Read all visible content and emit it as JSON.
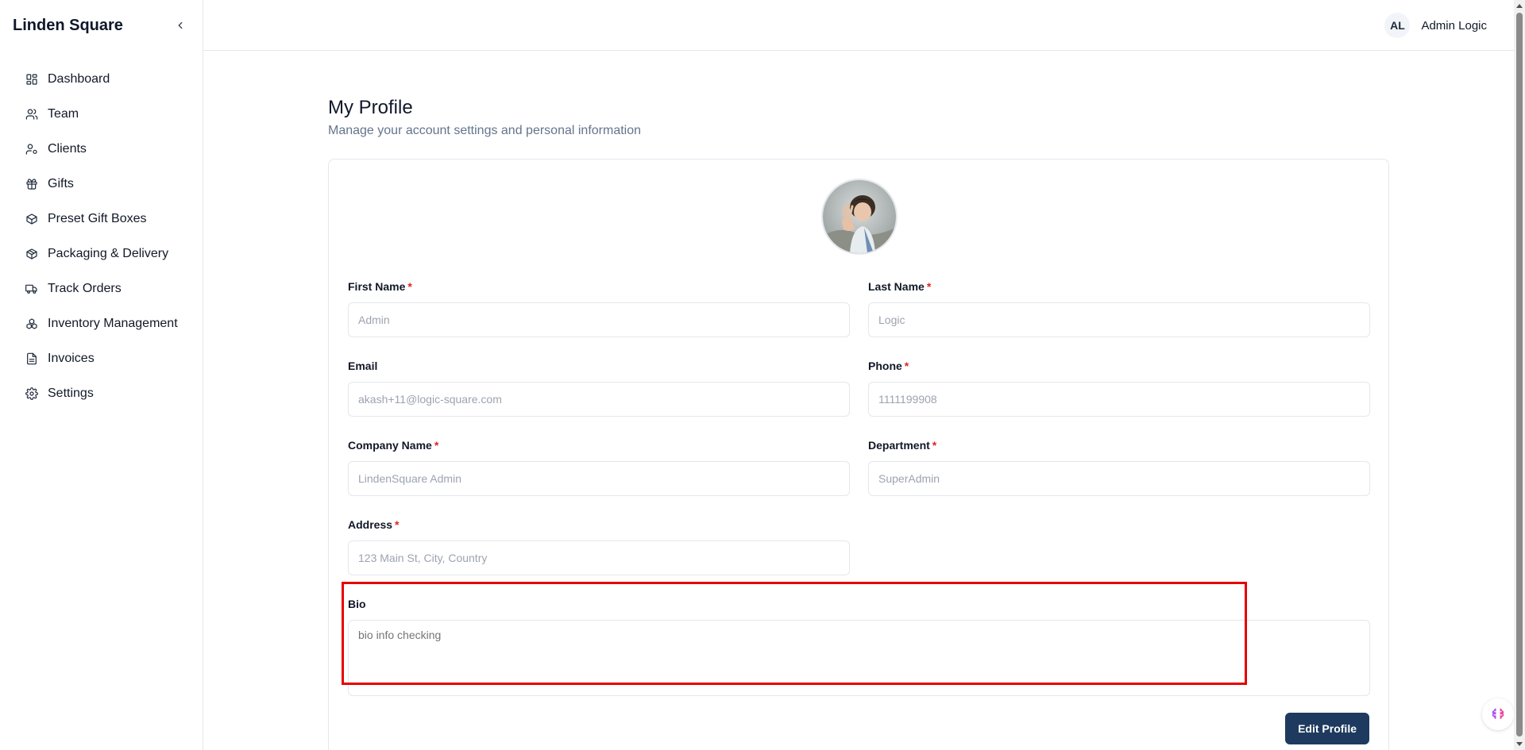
{
  "sidebar": {
    "brand": "Linden Square",
    "items": [
      {
        "label": "Dashboard",
        "icon": "dashboard-icon"
      },
      {
        "label": "Team",
        "icon": "team-icon"
      },
      {
        "label": "Clients",
        "icon": "clients-icon"
      },
      {
        "label": "Gifts",
        "icon": "gift-icon"
      },
      {
        "label": "Preset Gift Boxes",
        "icon": "box-icon"
      },
      {
        "label": "Packaging & Delivery",
        "icon": "package-icon"
      },
      {
        "label": "Track Orders",
        "icon": "truck-icon"
      },
      {
        "label": "Inventory Management",
        "icon": "boxes-icon"
      },
      {
        "label": "Invoices",
        "icon": "invoice-icon"
      },
      {
        "label": "Settings",
        "icon": "gear-icon"
      }
    ]
  },
  "header": {
    "user_initials": "AL",
    "user_name": "Admin Logic"
  },
  "page": {
    "title": "My Profile",
    "subtitle": "Manage your account settings and personal information"
  },
  "form": {
    "first_name": {
      "label": "First Name",
      "required": "*",
      "value": "Admin"
    },
    "last_name": {
      "label": "Last Name",
      "required": "*",
      "value": "Logic"
    },
    "email": {
      "label": "Email",
      "value": "akash+11@logic-square.com"
    },
    "phone": {
      "label": "Phone",
      "required": "*",
      "value": "1111199908"
    },
    "company": {
      "label": "Company Name",
      "required": "*",
      "value": "LindenSquare Admin"
    },
    "department": {
      "label": "Department",
      "required": "*",
      "value": "SuperAdmin"
    },
    "address": {
      "label": "Address",
      "required": "*",
      "value": "123 Main St, City, Country"
    },
    "bio": {
      "label": "Bio",
      "value": "bio info checking"
    }
  },
  "actions": {
    "edit_label": "Edit Profile"
  },
  "colors": {
    "primary_button": "#1e3a5f",
    "required_marker": "#dc2626",
    "highlight_box": "#e60000"
  }
}
